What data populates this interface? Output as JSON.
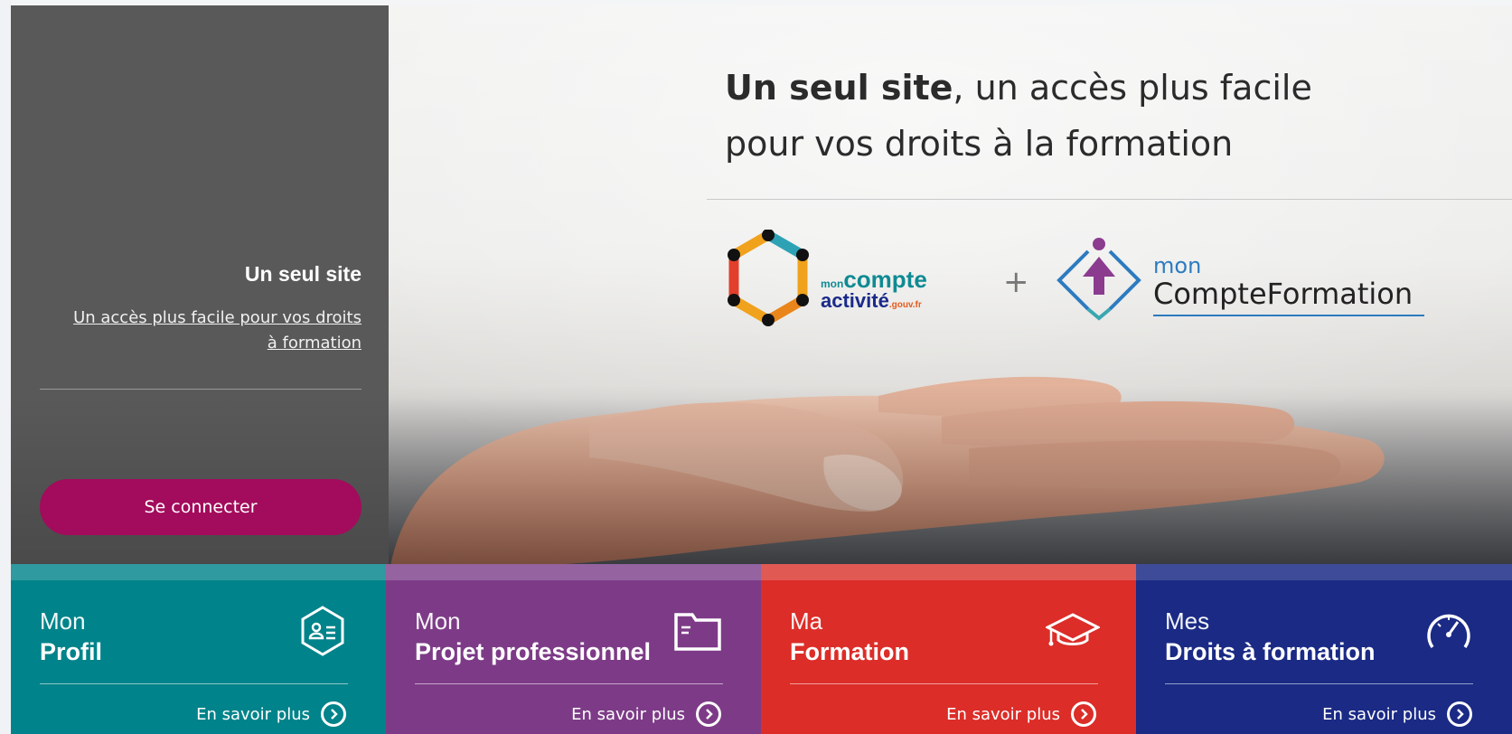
{
  "hero": {
    "headline_bold": "Un seul site",
    "headline_rest": ", un accès plus facile",
    "headline_line2": "pour vos droits à la formation"
  },
  "sidebar": {
    "title": "Un seul site",
    "link_text": "Un accès plus facile pour vos droits à formation",
    "connect_label": "Se connecter"
  },
  "logos": {
    "logo1_top_small": "mon",
    "logo1_top": "compte",
    "logo1_bottom": "activité",
    "logo1_suffix": ".gouv.fr",
    "plus": "+",
    "logo2_mon": "mon",
    "logo2_name": "CompteFormation"
  },
  "tiles": [
    {
      "small": "Mon",
      "big": "Profil",
      "more": "En savoir plus",
      "icon": "profile-card-icon",
      "color": "#00838a",
      "bar": "#2f9a9f"
    },
    {
      "small": "Mon",
      "big": "Projet professionnel",
      "more": "En savoir plus",
      "icon": "folder-icon",
      "color": "#7d3b87",
      "bar": "#9463a0"
    },
    {
      "small": "Ma",
      "big": "Formation",
      "more": "En savoir plus",
      "icon": "graduation-cap-icon",
      "color": "#dc2d28",
      "bar": "#e15953"
    },
    {
      "small": "Mes",
      "big": "Droits à formation",
      "more": "En savoir plus",
      "icon": "speedometer-icon",
      "color": "#1a2a85",
      "bar": "#3e4b98"
    }
  ]
}
